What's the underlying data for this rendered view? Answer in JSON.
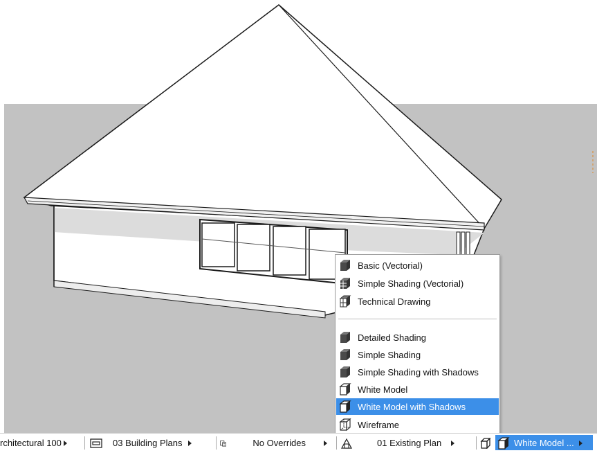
{
  "colors": {
    "ground": "#c2c2c2",
    "selection": "#3c8fe8",
    "icon_dark": "#4a4a4a"
  },
  "model_display_menu": {
    "items": [
      {
        "label": "Basic (Vectorial)",
        "icon": "shaded-cube-icon"
      },
      {
        "label": "Simple Shading (Vectorial)",
        "icon": "hatched-cube-icon"
      },
      {
        "label": "Technical Drawing",
        "icon": "technical-cube-icon"
      },
      {
        "label": "Detailed Shading",
        "icon": "shaded-cube-icon"
      },
      {
        "label": "Simple Shading",
        "icon": "shaded-cube-icon"
      },
      {
        "label": "Simple Shading with Shadows",
        "icon": "shaded-cube-icon"
      },
      {
        "label": "White Model",
        "icon": "white-cube-icon"
      },
      {
        "label": "White Model with Shadows",
        "icon": "white-cube-icon",
        "selected": true
      },
      {
        "label": "Wireframe",
        "icon": "wireframe-cube-icon"
      }
    ]
  },
  "status_bar": {
    "layer_combination": "rchitectural 100",
    "view": "03 Building Plans",
    "overrides": "No Overrides",
    "renovation_filter": "01 Existing Plan",
    "model_display": "White Model ..."
  }
}
